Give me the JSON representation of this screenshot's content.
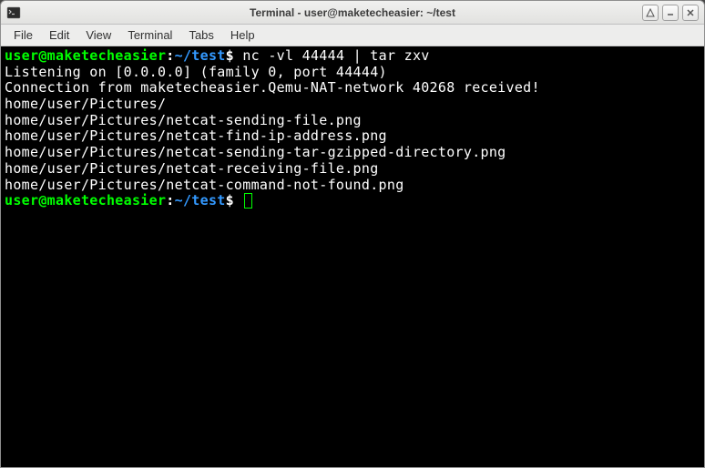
{
  "titlebar": {
    "title": "Terminal - user@maketecheasier: ~/test"
  },
  "menubar": {
    "file": "File",
    "edit": "Edit",
    "view": "View",
    "terminal": "Terminal",
    "tabs": "Tabs",
    "help": "Help"
  },
  "prompt": {
    "user_host": "user@maketecheasier",
    "path": "~/test",
    "dollar": "$"
  },
  "command1": "nc -vl 44444 | tar zxv",
  "output": {
    "l1": "Listening on [0.0.0.0] (family 0, port 44444)",
    "l2": "Connection from maketecheasier.Qemu-NAT-network 40268 received!",
    "l3": "home/user/Pictures/",
    "l4": "home/user/Pictures/netcat-sending-file.png",
    "l5": "home/user/Pictures/netcat-find-ip-address.png",
    "l6": "home/user/Pictures/netcat-sending-tar-gzipped-directory.png",
    "l7": "home/user/Pictures/netcat-receiving-file.png",
    "l8": "home/user/Pictures/netcat-command-not-found.png"
  }
}
